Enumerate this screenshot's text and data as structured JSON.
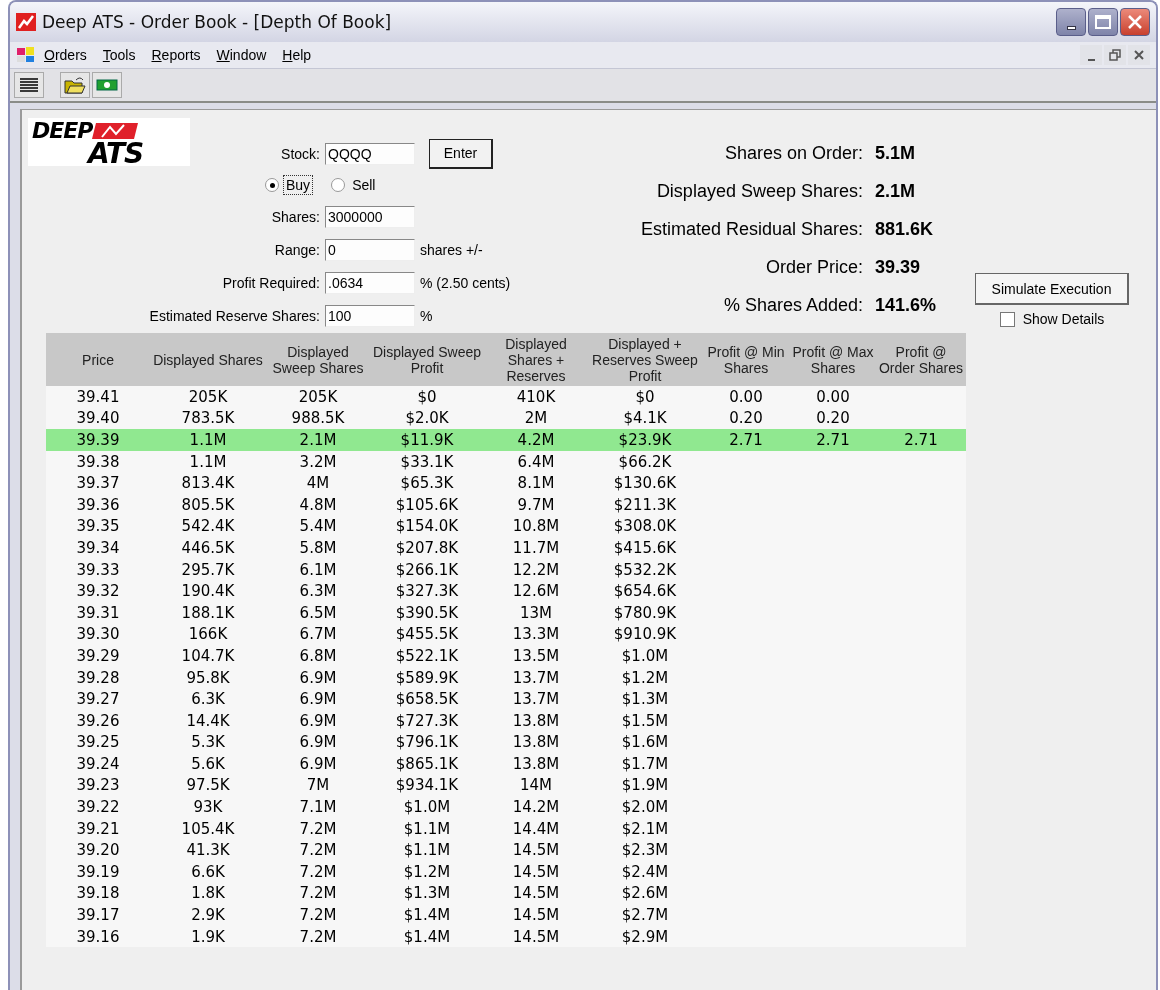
{
  "window": {
    "title": "Deep ATS - Order Book - [Depth Of Book]"
  },
  "menu": [
    "Orders",
    "Tools",
    "Reports",
    "Window",
    "Help"
  ],
  "logo": {
    "top": "DEEP",
    "bottom": "ATS"
  },
  "form": {
    "stock": {
      "label": "Stock:",
      "value": "QQQQ"
    },
    "enter_button": "Enter",
    "side": [
      {
        "label": "Buy",
        "selected": true
      },
      {
        "label": "Sell",
        "selected": false
      }
    ],
    "fields": [
      {
        "label": "Shares:",
        "value": "3000000"
      },
      {
        "label": "Range:",
        "value": "0",
        "unit": "shares +/-"
      },
      {
        "label": "Profit Required:",
        "value": ".0634",
        "unit": "% (2.50 cents)"
      },
      {
        "label": "Estimated Reserve Shares:",
        "value": "100",
        "unit": "%"
      }
    ]
  },
  "summary": [
    {
      "label": "Shares on Order:",
      "value": "5.1M"
    },
    {
      "label": "Displayed Sweep Shares:",
      "value": "2.1M"
    },
    {
      "label": "Estimated Residual Shares:",
      "value": "881.6K"
    },
    {
      "label": "Order Price:",
      "value": "39.39"
    },
    {
      "label": "% Shares Added:",
      "value": "141.6%"
    }
  ],
  "simulate_button": "Simulate Execution",
  "show_details": {
    "label": "Show Details",
    "checked": false
  },
  "table": {
    "columns": [
      "Price",
      "Displayed Shares",
      "Displayed Sweep Shares",
      "Displayed Sweep Profit",
      "Displayed Shares + Reserves",
      "Displayed + Reserves Sweep Profit",
      "Profit @ Min Shares",
      "Profit @ Max Shares",
      "Profit @ Order Shares"
    ],
    "rows": [
      {
        "selected": false,
        "cells": [
          "39.41",
          "205K",
          "205K",
          "$0",
          "410K",
          "$0",
          "0.00",
          "0.00"
        ]
      },
      {
        "selected": false,
        "cells": [
          "39.40",
          "783.5K",
          "988.5K",
          "$2.0K",
          "2M",
          "$4.1K",
          "0.20",
          "0.20"
        ]
      },
      {
        "selected": true,
        "cells": [
          "39.39",
          "1.1M",
          "2.1M",
          "$11.9K",
          "4.2M",
          "$23.9K",
          "2.71",
          "2.71",
          "2.71"
        ]
      },
      {
        "selected": false,
        "cells": [
          "39.38",
          "1.1M",
          "3.2M",
          "$33.1K",
          "6.4M",
          "$66.2K"
        ]
      },
      {
        "selected": false,
        "cells": [
          "39.37",
          "813.4K",
          "4M",
          "$65.3K",
          "8.1M",
          "$130.6K"
        ]
      },
      {
        "selected": false,
        "cells": [
          "39.36",
          "805.5K",
          "4.8M",
          "$105.6K",
          "9.7M",
          "$211.3K"
        ]
      },
      {
        "selected": false,
        "cells": [
          "39.35",
          "542.4K",
          "5.4M",
          "$154.0K",
          "10.8M",
          "$308.0K"
        ]
      },
      {
        "selected": false,
        "cells": [
          "39.34",
          "446.5K",
          "5.8M",
          "$207.8K",
          "11.7M",
          "$415.6K"
        ]
      },
      {
        "selected": false,
        "cells": [
          "39.33",
          "295.7K",
          "6.1M",
          "$266.1K",
          "12.2M",
          "$532.2K"
        ]
      },
      {
        "selected": false,
        "cells": [
          "39.32",
          "190.4K",
          "6.3M",
          "$327.3K",
          "12.6M",
          "$654.6K"
        ]
      },
      {
        "selected": false,
        "cells": [
          "39.31",
          "188.1K",
          "6.5M",
          "$390.5K",
          "13M",
          "$780.9K"
        ]
      },
      {
        "selected": false,
        "cells": [
          "39.30",
          "166K",
          "6.7M",
          "$455.5K",
          "13.3M",
          "$910.9K"
        ]
      },
      {
        "selected": false,
        "cells": [
          "39.29",
          "104.7K",
          "6.8M",
          "$522.1K",
          "13.5M",
          "$1.0M"
        ]
      },
      {
        "selected": false,
        "cells": [
          "39.28",
          "95.8K",
          "6.9M",
          "$589.9K",
          "13.7M",
          "$1.2M"
        ]
      },
      {
        "selected": false,
        "cells": [
          "39.27",
          "6.3K",
          "6.9M",
          "$658.5K",
          "13.7M",
          "$1.3M"
        ]
      },
      {
        "selected": false,
        "cells": [
          "39.26",
          "14.4K",
          "6.9M",
          "$727.3K",
          "13.8M",
          "$1.5M"
        ]
      },
      {
        "selected": false,
        "cells": [
          "39.25",
          "5.3K",
          "6.9M",
          "$796.1K",
          "13.8M",
          "$1.6M"
        ]
      },
      {
        "selected": false,
        "cells": [
          "39.24",
          "5.6K",
          "6.9M",
          "$865.1K",
          "13.8M",
          "$1.7M"
        ]
      },
      {
        "selected": false,
        "cells": [
          "39.23",
          "97.5K",
          "7M",
          "$934.1K",
          "14M",
          "$1.9M"
        ]
      },
      {
        "selected": false,
        "cells": [
          "39.22",
          "93K",
          "7.1M",
          "$1.0M",
          "14.2M",
          "$2.0M"
        ]
      },
      {
        "selected": false,
        "cells": [
          "39.21",
          "105.4K",
          "7.2M",
          "$1.1M",
          "14.4M",
          "$2.1M"
        ]
      },
      {
        "selected": false,
        "cells": [
          "39.20",
          "41.3K",
          "7.2M",
          "$1.1M",
          "14.5M",
          "$2.3M"
        ]
      },
      {
        "selected": false,
        "cells": [
          "39.19",
          "6.6K",
          "7.2M",
          "$1.2M",
          "14.5M",
          "$2.4M"
        ]
      },
      {
        "selected": false,
        "cells": [
          "39.18",
          "1.8K",
          "7.2M",
          "$1.3M",
          "14.5M",
          "$2.6M"
        ]
      },
      {
        "selected": false,
        "cells": [
          "39.17",
          "2.9K",
          "7.2M",
          "$1.4M",
          "14.5M",
          "$2.7M"
        ]
      },
      {
        "selected": false,
        "cells": [
          "39.16",
          "1.9K",
          "7.2M",
          "$1.4M",
          "14.5M",
          "$2.9M"
        ]
      }
    ]
  }
}
